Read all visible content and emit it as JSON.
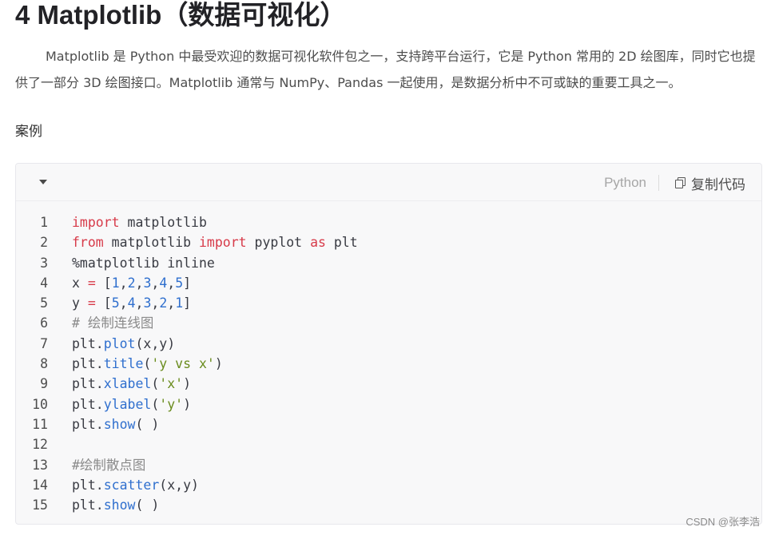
{
  "heading": "4 Matplotlib（数据可视化）",
  "paragraph": "Matplotlib 是 Python 中最受欢迎的数据可视化软件包之一，支持跨平台运行，它是 Python 常用的 2D 绘图库，同时它也提供了一部分 3D 绘图接口。Matplotlib 通常与 NumPy、Pandas 一起使用，是数据分析中不可或缺的重要工具之一。",
  "case_label": "案例",
  "code_block": {
    "language": "Python",
    "copy_label": "复制代码",
    "toggle_icon": "caret-down-icon",
    "copy_icon": "copy-icon",
    "lines": [
      {
        "num": "1",
        "tokens": [
          [
            "kw",
            "import"
          ],
          [
            "",
            " matplotlib"
          ]
        ]
      },
      {
        "num": "2",
        "tokens": [
          [
            "kw",
            "from"
          ],
          [
            "",
            " matplotlib "
          ],
          [
            "kw",
            "import"
          ],
          [
            "",
            " pyplot "
          ],
          [
            "kw",
            "as"
          ],
          [
            "",
            " plt"
          ]
        ]
      },
      {
        "num": "3",
        "tokens": [
          [
            "",
            "%matplotlib inline"
          ]
        ]
      },
      {
        "num": "4",
        "tokens": [
          [
            "",
            "x "
          ],
          [
            "op",
            "="
          ],
          [
            "",
            " ["
          ],
          [
            "num",
            "1"
          ],
          [
            "",
            ","
          ],
          [
            "num",
            "2"
          ],
          [
            "",
            ","
          ],
          [
            "num",
            "3"
          ],
          [
            "",
            ","
          ],
          [
            "num",
            "4"
          ],
          [
            "",
            ","
          ],
          [
            "num",
            "5"
          ],
          [
            "",
            "]"
          ]
        ]
      },
      {
        "num": "5",
        "tokens": [
          [
            "",
            "y "
          ],
          [
            "op",
            "="
          ],
          [
            "",
            " ["
          ],
          [
            "num",
            "5"
          ],
          [
            "",
            ","
          ],
          [
            "num",
            "4"
          ],
          [
            "",
            ","
          ],
          [
            "num",
            "3"
          ],
          [
            "",
            ","
          ],
          [
            "num",
            "2"
          ],
          [
            "",
            ","
          ],
          [
            "num",
            "1"
          ],
          [
            "",
            "]"
          ]
        ]
      },
      {
        "num": "6",
        "tokens": [
          [
            "cm",
            "# 绘制连线图"
          ]
        ]
      },
      {
        "num": "7",
        "tokens": [
          [
            "",
            "plt."
          ],
          [
            "fn",
            "plot"
          ],
          [
            "",
            "(x,y)"
          ]
        ]
      },
      {
        "num": "8",
        "tokens": [
          [
            "",
            "plt."
          ],
          [
            "fn",
            "title"
          ],
          [
            "",
            "("
          ],
          [
            "str",
            "'y vs x'"
          ],
          [
            "",
            ")"
          ]
        ]
      },
      {
        "num": "9",
        "tokens": [
          [
            "",
            "plt."
          ],
          [
            "fn",
            "xlabel"
          ],
          [
            "",
            "("
          ],
          [
            "str",
            "'x'"
          ],
          [
            "",
            ")"
          ]
        ]
      },
      {
        "num": "10",
        "tokens": [
          [
            "",
            "plt."
          ],
          [
            "fn",
            "ylabel"
          ],
          [
            "",
            "("
          ],
          [
            "str",
            "'y'"
          ],
          [
            "",
            ")"
          ]
        ]
      },
      {
        "num": "11",
        "tokens": [
          [
            "",
            "plt."
          ],
          [
            "fn",
            "show"
          ],
          [
            "",
            "( )"
          ]
        ]
      },
      {
        "num": "12",
        "tokens": []
      },
      {
        "num": "13",
        "tokens": [
          [
            "cm",
            "#绘制散点图"
          ]
        ]
      },
      {
        "num": "14",
        "tokens": [
          [
            "",
            "plt."
          ],
          [
            "fn",
            "scatter"
          ],
          [
            "",
            "(x,y)"
          ]
        ]
      },
      {
        "num": "15",
        "tokens": [
          [
            "",
            "plt."
          ],
          [
            "fn",
            "show"
          ],
          [
            "",
            "( )"
          ]
        ]
      }
    ]
  },
  "watermark": "CSDN @张李浩",
  "colors": {
    "keyword": "#d73a49",
    "function": "#2f6fce",
    "number": "#2f6fce",
    "string": "#6a8c1e",
    "comment": "#8a8a8a",
    "code_background": "#f8f8f9"
  }
}
